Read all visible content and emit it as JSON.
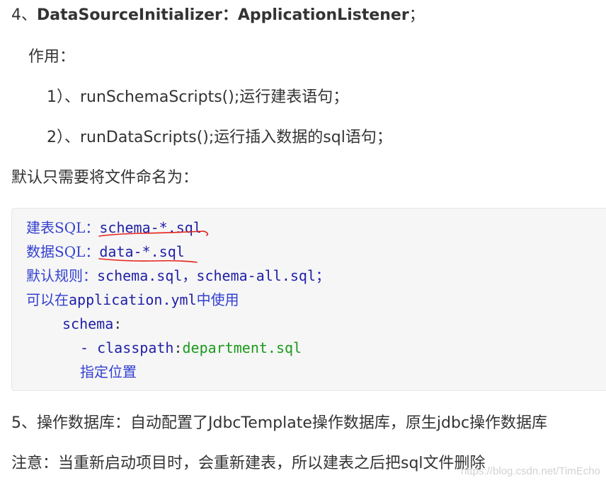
{
  "heading": {
    "number": "4、",
    "bold": "DataSourceInitializer：ApplicationListener",
    "suffix": "；"
  },
  "purpose_label": "作用：",
  "items": [
    "1）、runSchemaScripts();运行建表语句；",
    "2）、runDataScripts();运行插入数据的sql语句；"
  ],
  "default_naming": "默认只需要将文件命名为：",
  "code": {
    "line1_label": "建表SQL：",
    "line1_value": "schema-*.sql",
    "line2_label": "数据SQL：",
    "line2_value": "data-*.sql",
    "line3_label": "默认规则：",
    "line3_value": "schema.sql，schema-all.sql；",
    "line4_pre": "可以在",
    "line4_file": "application.yml",
    "line4_post": "中使用",
    "line5_key": "schema",
    "line5_colon": ":",
    "line6_dash": "- classpath",
    "line6_colon": ":",
    "line6_value": "department.sql",
    "line7": "指定位置"
  },
  "section5": "5、操作数据库：自动配置了JdbcTemplate操作数据库，原生jdbc操作数据库",
  "note": "注意：当重新启动项目时，会重新建表，所以建表之后把sql文件删除",
  "watermark": "https://blog.csdn.net/TimEcho",
  "colors": {
    "annotation": "#e8201a",
    "code_keyword": "#1f1fa8",
    "code_string": "#1a9a1a"
  }
}
